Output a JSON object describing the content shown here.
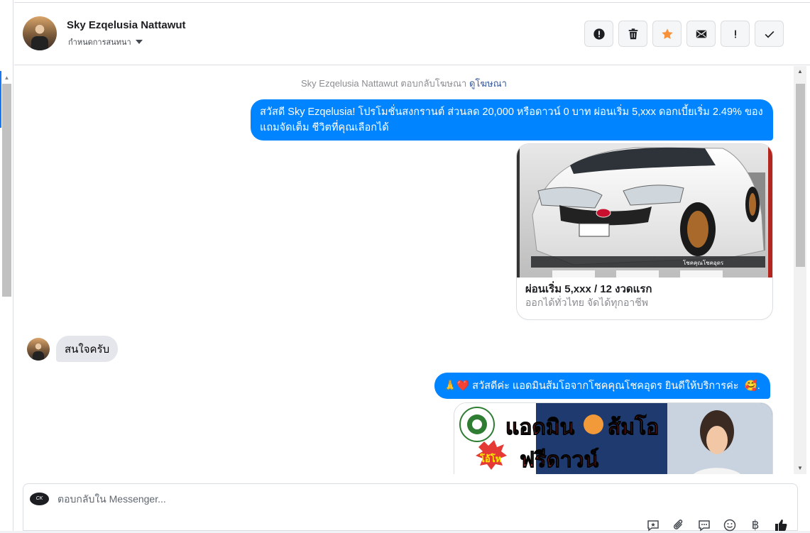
{
  "header": {
    "contact_name": "Sky Ezqelusia Nattawut",
    "assign_label": "กำหนดการสนทนา",
    "actions": [
      {
        "name": "mark-spam-button",
        "icon": "alert-circle-icon"
      },
      {
        "name": "delete-button",
        "icon": "trash-icon"
      },
      {
        "name": "star-button",
        "icon": "star-icon"
      },
      {
        "name": "mark-unread-button",
        "icon": "envelope-icon"
      },
      {
        "name": "follow-up-button",
        "icon": "exclamation-icon"
      },
      {
        "name": "mark-done-button",
        "icon": "check-icon"
      }
    ],
    "star_color": "#f7923b"
  },
  "chat": {
    "reply_note": "Sky Ezqelusia Nattawut ตอบกลับโฆษณา",
    "reply_note_link": "ดูโฆษณา",
    "message_1": "สวัสดี Sky Ezqelusia! โปรโมชั่นสงกรานต์ ส่วนลด 20,000 หรือดาวน์ 0 บาท ผ่อนเริ่ม 5,xxx ดอกเบี้ยเริ่ม 2.49% ของแถมจัดเต็ม ชีวิตที่คุณเลือกได้",
    "card_title": "ผ่อนเริ่ม 5,xxx / 12 งวดแรก",
    "card_subtitle": "ออกได้ทั่วไทย จัดได้ทุกอาชีพ",
    "card_image_caption": "โชคคุณโชคอุดร",
    "incoming_message": "สนใจครับ",
    "message_3_emoji_prefix": "🙏❤️",
    "message_3": "สวัสดีค่ะ แอดมินส้มโอจากโชคคุณโชคอุดร ยินดีให้บริการค่ะ",
    "message_3_emoji_suffix": "🥰.",
    "card2_headline": "แอดมิน",
    "card2_headline_2": "ส้มโอ",
    "card2_badge": "โอ้โห",
    "card2_promo": "ฟรีดาวน์",
    "bubble_color": "#0084ff"
  },
  "composer": {
    "page_logo_text": "CK",
    "placeholder": "ตอบกลับใน Messenger...",
    "tools": [
      "saved-reply-icon",
      "attachment-icon",
      "chat-bubble-icon",
      "emoji-icon",
      "baht-icon",
      "thumbs-up-icon"
    ],
    "baht_symbol": "฿"
  }
}
